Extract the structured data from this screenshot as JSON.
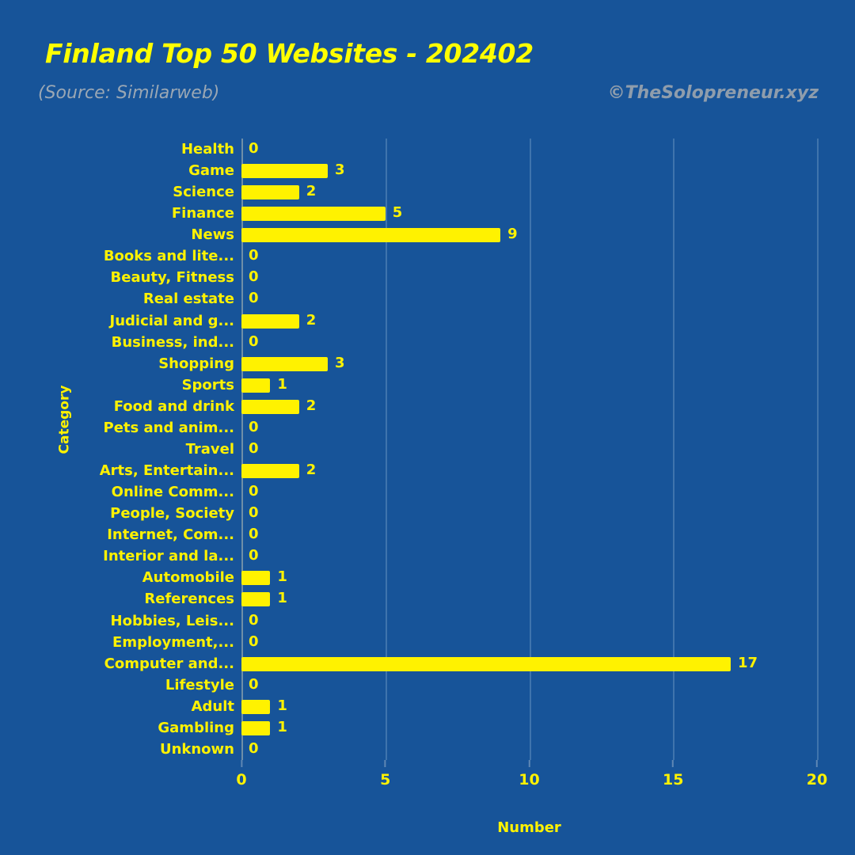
{
  "header": {
    "title": "Finland Top 50 Websites - 202402",
    "subtitle": "(Source: Similarweb)",
    "watermark": "©TheSolopreneur.xyz"
  },
  "colors": {
    "background": "#175499",
    "bar": "#FFF200",
    "text": "#FFF200",
    "subtitle": "#9AA7B4",
    "gridline": "#3F74AD"
  },
  "chart_data": {
    "type": "bar",
    "orientation": "horizontal",
    "title": "Finland Top 50 Websites - 202402",
    "subtitle": "(Source: Similarweb)",
    "xlabel": "Number",
    "ylabel": "Category",
    "xlim": [
      0,
      20
    ],
    "xticks": [
      0,
      5,
      10,
      15,
      20
    ],
    "xtick_labels": [
      "0",
      "5",
      "10",
      "15",
      "20"
    ],
    "grid": true,
    "legend": false,
    "categories": [
      "Health",
      "Game",
      "Science",
      "Finance",
      "News",
      "Books and lite...",
      "Beauty, Fitness",
      "Real estate",
      "Judicial and g...",
      "Business, ind...",
      "Shopping",
      "Sports",
      "Food and drink",
      "Pets and anim...",
      "Travel",
      "Arts, Entertain...",
      "Online Comm...",
      "People, Society",
      "Internet, Com...",
      "Interior and la...",
      "Automobile",
      "References",
      "Hobbies, Leis...",
      "Employment,...",
      "Computer and...",
      "Lifestyle",
      "Adult",
      "Gambling",
      "Unknown"
    ],
    "values": [
      0,
      3,
      2,
      5,
      9,
      0,
      0,
      0,
      2,
      0,
      3,
      1,
      2,
      0,
      0,
      2,
      0,
      0,
      0,
      0,
      1,
      1,
      0,
      0,
      17,
      0,
      1,
      1,
      0
    ],
    "value_labels": [
      "0",
      "3",
      "2",
      "5",
      "9",
      "0",
      "0",
      "0",
      "2",
      "0",
      "3",
      "1",
      "2",
      "0",
      "0",
      "2",
      "0",
      "0",
      "0",
      "0",
      "1",
      "1",
      "0",
      "0",
      "17",
      "0",
      "1",
      "1",
      "0"
    ]
  }
}
